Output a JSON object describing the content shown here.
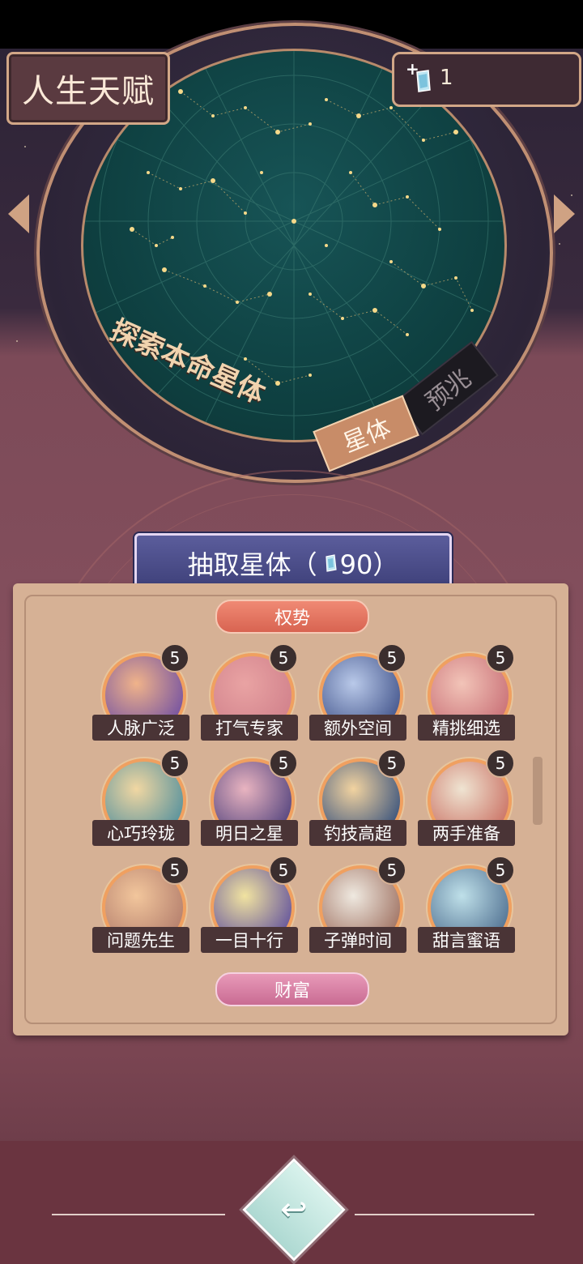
{
  "header": {
    "title": "人生天赋",
    "gem_count": "1"
  },
  "dial": {
    "explore_text": "探索本命星体",
    "tabs": [
      {
        "label": "星体",
        "active": true
      },
      {
        "label": "预兆",
        "active": false
      }
    ]
  },
  "draw_button": {
    "label": "抽取星体（",
    "cost": "90）"
  },
  "categories": [
    {
      "label": "权势"
    },
    {
      "label": "财富"
    }
  ],
  "talents": [
    {
      "name": "人脉广泛",
      "level": "5"
    },
    {
      "name": "打气专家",
      "level": "5"
    },
    {
      "name": "额外空间",
      "level": "5"
    },
    {
      "name": "精挑细选",
      "level": "5"
    },
    {
      "name": "心巧玲珑",
      "level": "5"
    },
    {
      "name": "明日之星",
      "level": "5"
    },
    {
      "name": "钓技高超",
      "level": "5"
    },
    {
      "name": "两手准备",
      "level": "5"
    },
    {
      "name": "问题先生",
      "level": "5"
    },
    {
      "name": "一目十行",
      "level": "5"
    },
    {
      "name": "子弹时间",
      "level": "5"
    },
    {
      "name": "甜言蜜语",
      "level": "5"
    }
  ],
  "footer": {
    "back_icon": "back-arrow-icon"
  },
  "colors": {
    "accent_gold": "#d2a787",
    "badge_dark": "#3b2e2e",
    "orb_ring": "#f0a060",
    "draw_button": "#4b4d8a"
  }
}
